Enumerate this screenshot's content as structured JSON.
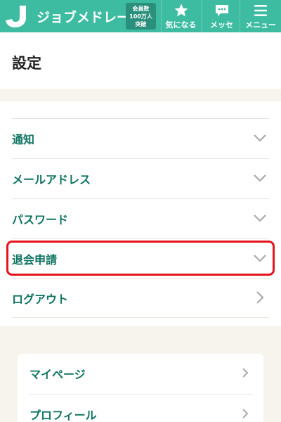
{
  "header": {
    "logo_text": "ジョブメドレー",
    "badge": [
      "会員数",
      "100万人",
      "突破"
    ],
    "nav": {
      "favorites_label": "気になる",
      "messages_label": "メッセ",
      "menu_label": "メニュー"
    },
    "brand_color": "#3dbca1"
  },
  "page": {
    "title": "設定"
  },
  "settings": {
    "items": [
      {
        "label": "通知",
        "icon": "chevron-down-icon"
      },
      {
        "label": "メールアドレス",
        "icon": "chevron-down-icon"
      },
      {
        "label": "パスワード",
        "icon": "chevron-down-icon"
      },
      {
        "label": "退会申請",
        "icon": "chevron-down-icon",
        "highlighted": true
      },
      {
        "label": "ログアウト",
        "icon": "chevron-right-icon"
      }
    ],
    "highlight_color": "#e5131d",
    "text_color": "#0f7462"
  },
  "account_links": {
    "items": [
      {
        "label": "マイページ",
        "icon": "chevron-right-icon"
      },
      {
        "label": "プロフィール",
        "icon": "chevron-right-icon"
      }
    ]
  }
}
